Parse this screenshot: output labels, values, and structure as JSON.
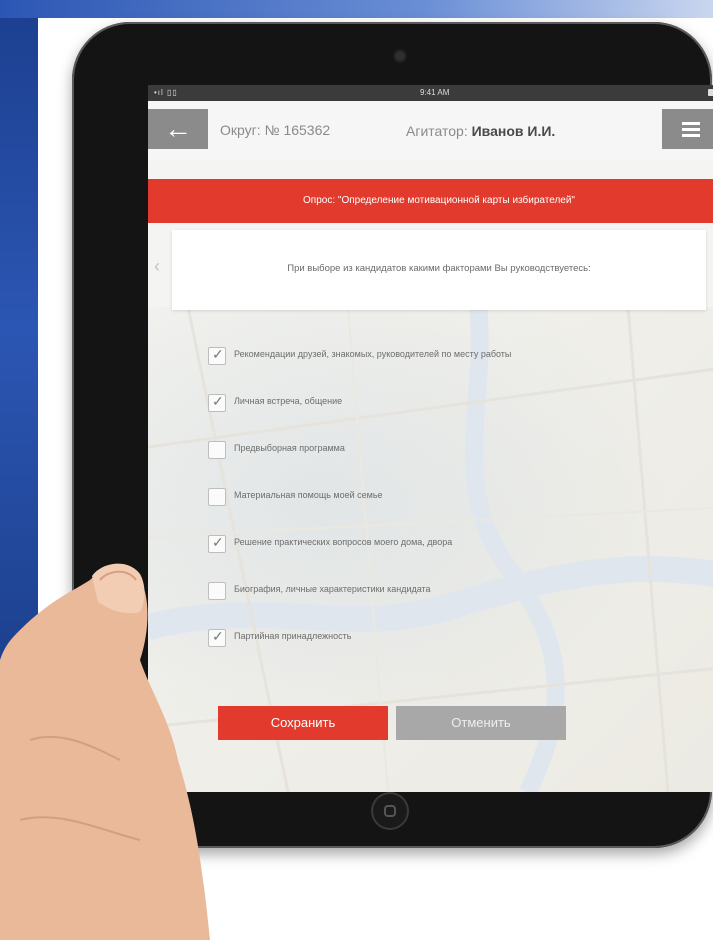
{
  "device": {
    "status_left": "•ıl ▯▯",
    "status_time": "9:41 AM"
  },
  "header": {
    "back_icon": "arrow-left-icon",
    "district_label": "Округ: № 165362",
    "agitator_prefix": "Агитатор: ",
    "agitator_name": "Иванов И.И.",
    "menu_icon": "hamburger-menu-icon"
  },
  "survey": {
    "banner": "Опрос: \"Определение мотивационной карты избирателей\"",
    "question": "При выборе из кандидатов какими факторами Вы руководствуетесь:",
    "prev_icon": "chevron-left-icon",
    "next_icon": "chevron-right-icon",
    "options": [
      {
        "label": "Рекомендации друзей, знакомых, руководителей по месту работы",
        "checked": true
      },
      {
        "label": "Личная встреча, общение",
        "checked": true
      },
      {
        "label": "Предвыборная программа",
        "checked": false
      },
      {
        "label": "Материальная помощь моей семье",
        "checked": false
      },
      {
        "label": "Решение практических вопросов моего дома, двора",
        "checked": true
      },
      {
        "label": "Биография, личные характеристики кандидата",
        "checked": false
      },
      {
        "label": "Партийная принадлежность",
        "checked": true
      }
    ]
  },
  "actions": {
    "save_label": "Сохранить",
    "cancel_label": "Отменить"
  },
  "colors": {
    "accent_red": "#e23b2e",
    "header_button_gray": "#8b8b8b",
    "cancel_gray": "#a8a8a8",
    "tablet_frame": "#141414"
  }
}
